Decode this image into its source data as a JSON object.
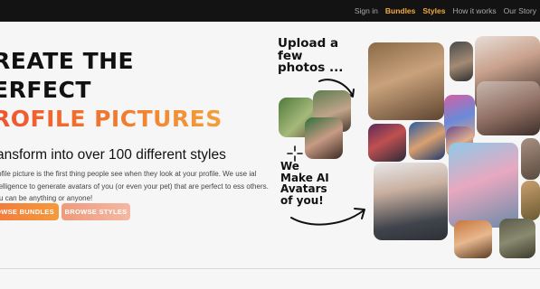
{
  "nav": {
    "items": [
      {
        "label": "Sign in",
        "highlight": false
      },
      {
        "label": "Bundles",
        "highlight": true
      },
      {
        "label": "Styles",
        "highlight": true
      },
      {
        "label": "How it works",
        "highlight": false
      },
      {
        "label": "Our Story",
        "highlight": false
      }
    ]
  },
  "hero": {
    "title_line1": "REATE THE",
    "title_line2": "ERFECT",
    "title_line3": "ROFILE PICTURES",
    "subtitle": "ansform into over 100 different styles",
    "description": "profile picture is the first thing people see when they look at your profile. We use ial intelligence to generate avatars of you (or even your pet) that are perfect to ess others. You can be anything or anyone!",
    "primary_button": "OWSE BUNDLES",
    "secondary_button": "BROWSE STYLES"
  },
  "illustration": {
    "upload_lines": [
      "Upload a",
      "few",
      "photos ..."
    ],
    "ai_lines": [
      "We",
      "Make AI",
      "Avatars",
      "of you!"
    ]
  },
  "colors": {
    "nav_bar": "#131313",
    "nav_text": "#a8a8a8",
    "nav_highlight": "#f4a93c",
    "accent_orange": "#f27a3c"
  }
}
